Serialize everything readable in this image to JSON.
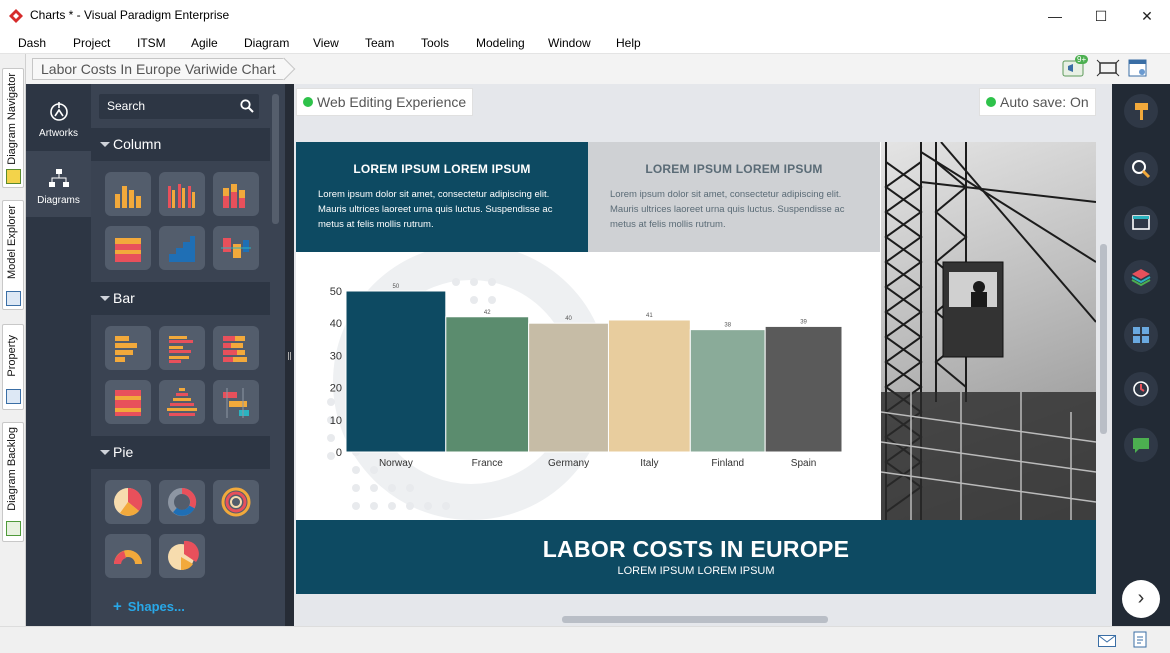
{
  "window": {
    "title": "Charts * - Visual Paradigm Enterprise",
    "minimize": "—",
    "maximize": "☐",
    "close": "✕"
  },
  "menu": [
    "Dash",
    "Project",
    "ITSM",
    "Agile",
    "Diagram",
    "View",
    "Team",
    "Tools",
    "Modeling",
    "Window",
    "Help"
  ],
  "left_tabs": [
    "Diagram Navigator",
    "Model Explorer",
    "Property",
    "Diagram Backlog"
  ],
  "breadcrumb": "Labor Costs In Europe Variwide Chart",
  "toolbar": {
    "notification_badge": "9+"
  },
  "nav": {
    "artworks": "Artworks",
    "diagrams": "Diagrams"
  },
  "palette": {
    "search_placeholder": "Search",
    "sections": [
      "Column",
      "Bar",
      "Pie"
    ],
    "add_shapes": "Shapes..."
  },
  "canvas": {
    "web_editing": "Web Editing Experience",
    "autosave": "Auto save: On"
  },
  "slide": {
    "box1_title": "LOREM IPSUM LOREM IPSUM",
    "box1_text": "Lorem ipsum dolor sit amet, consectetur adipiscing elit. Mauris ultrices laoreet urna quis luctus. Suspendisse ac metus at felis mollis rutrum.",
    "box2_title": "LOREM IPSUM LOREM IPSUM",
    "box2_text": "Lorem ipsum dolor sit amet, consectetur adipiscing elit. Mauris ultrices laoreet urna quis luctus. Suspendisse ac metus at felis mollis rutrum.",
    "footer_title": "LABOR COSTS IN EUROPE",
    "footer_subtitle": "LOREM IPSUM LOREM IPSUM"
  },
  "chart_data": {
    "type": "bar",
    "variant": "variwide",
    "categories": [
      "Norway",
      "France",
      "Germany",
      "Italy",
      "Finland",
      "Spain"
    ],
    "values": [
      50,
      42,
      40,
      41,
      38,
      39
    ],
    "widths": [
      100,
      83,
      80,
      82,
      75,
      77
    ],
    "colors": [
      "#0d4a62",
      "#5b8c6e",
      "#c6bca6",
      "#e8cd9e",
      "#8aab99",
      "#5a5a5a"
    ],
    "ylim": [
      0,
      50
    ],
    "yticks": [
      0,
      10,
      20,
      30,
      40,
      50
    ],
    "grid": false
  },
  "colors": {
    "dark_blue": "#0d4a62",
    "sidebar_bg": "#2d3644",
    "accent_green": "#2ec24a",
    "link_blue": "#28a8e8"
  }
}
